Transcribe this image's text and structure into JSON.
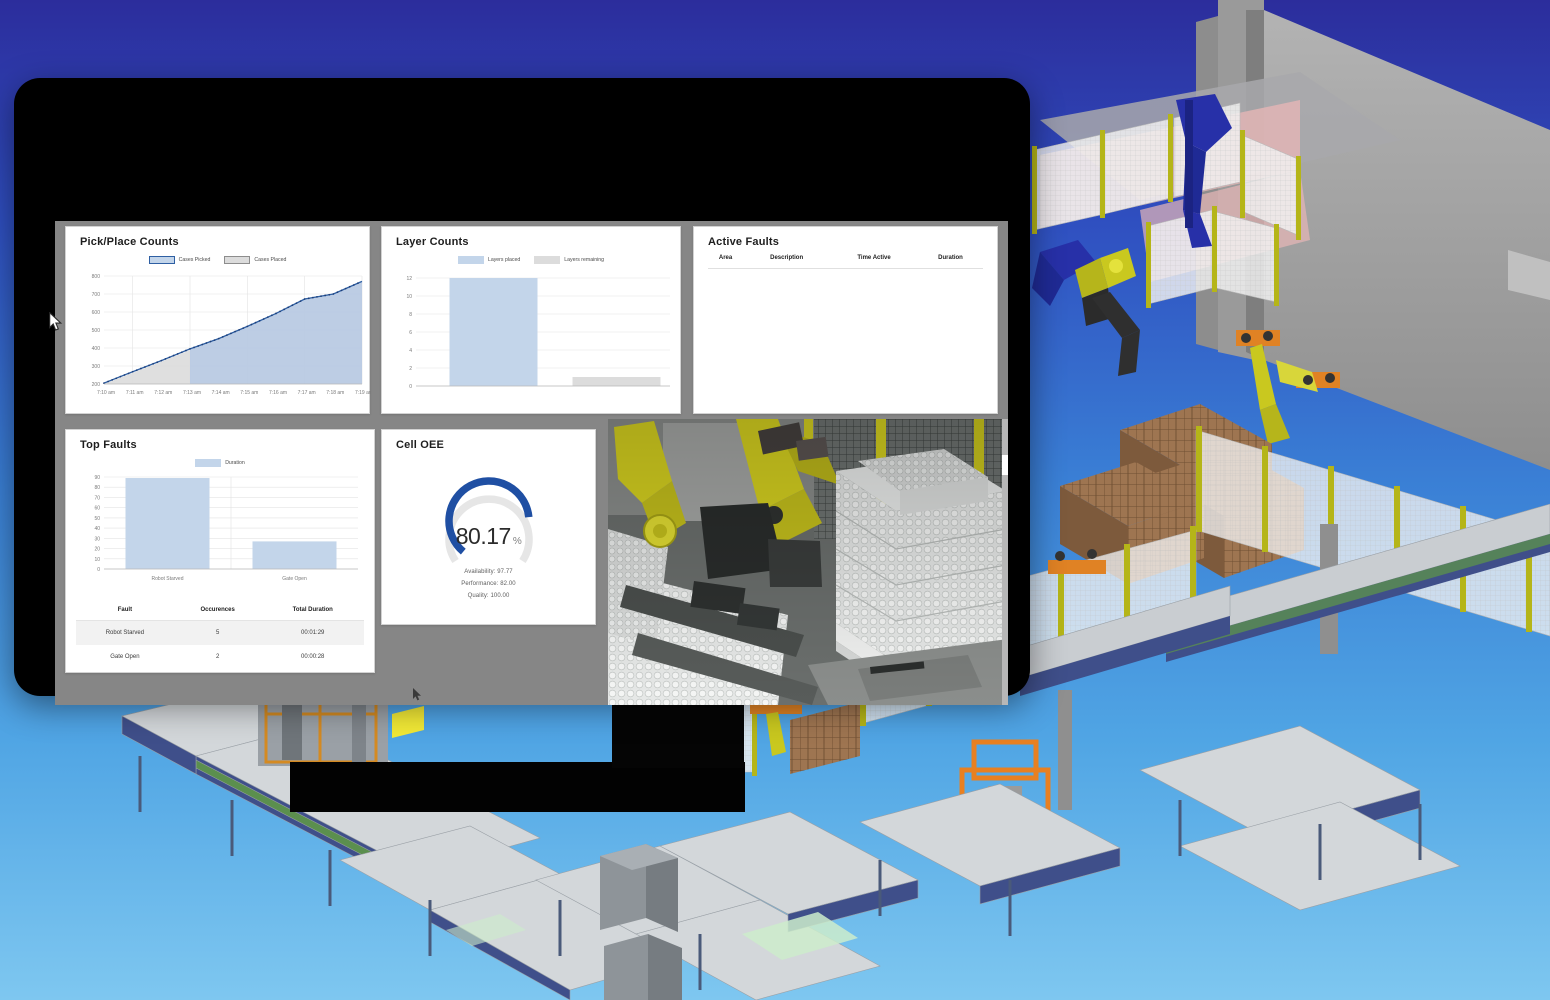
{
  "dashboard": {
    "panels": {
      "pick_place": {
        "title": "Pick/Place Counts"
      },
      "layer_counts": {
        "title": "Layer Counts"
      },
      "active_faults": {
        "title": "Active Faults"
      },
      "top_faults": {
        "title": "Top Faults"
      },
      "cell_oee": {
        "title": "Cell OEE"
      }
    },
    "active_faults_table": {
      "columns": [
        "Area",
        "Description",
        "Time Active",
        "Duration"
      ],
      "rows": []
    },
    "top_faults_table": {
      "columns": [
        "Fault",
        "Occurences",
        "Total Duration"
      ],
      "rows": [
        {
          "fault": "Robot Starved",
          "occurences": "5",
          "total_duration": "00:01:29"
        },
        {
          "fault": "Gate Open",
          "occurences": "2",
          "total_duration": "00:00:28"
        }
      ]
    },
    "cell_oee": {
      "value": "80.17",
      "unit": "%",
      "availability": "Availability: 97.77",
      "performance": "Performance: 82.00",
      "quality": "Quality: 100.00"
    },
    "camera": {
      "label": "live-camera-feed"
    }
  },
  "colors": {
    "accent_blue": "#1f4fa3",
    "series_blue": "#c3d5ea",
    "series_gray": "#dcdcdc",
    "panel_bg": "#ffffff",
    "dashboard_bg": "#868686",
    "gauge_track": "#e6e6e6"
  },
  "chart_data": [
    {
      "id": "pick-place-counts",
      "type": "area",
      "title": "Pick/Place Counts",
      "xlabel": "",
      "ylabel": "",
      "legend": [
        "Cases Picked",
        "Cases Placed"
      ],
      "legend_position": "top",
      "grid": true,
      "x": [
        "7:10 am",
        "7:11 am",
        "7:12 am",
        "7:13 am",
        "7:14 am",
        "7:15 am",
        "7:16 am",
        "7:17 am",
        "7:18 am",
        "7:19 am"
      ],
      "ylim": [
        200,
        800
      ],
      "yticks": [
        200,
        300,
        400,
        500,
        600,
        700,
        800
      ],
      "series": [
        {
          "name": "Cases Picked",
          "values": [
            205,
            268,
            330,
            395,
            452,
            520,
            592,
            672,
            700,
            770
          ]
        },
        {
          "name": "Cases Placed",
          "values": [
            200,
            262,
            324,
            388,
            446,
            512,
            584,
            664,
            692,
            762
          ]
        }
      ]
    },
    {
      "id": "layer-counts",
      "type": "bar",
      "title": "Layer Counts",
      "xlabel": "",
      "ylabel": "",
      "legend": [
        "Layers placed",
        "Layers remaining"
      ],
      "legend_position": "top",
      "grid": true,
      "categories": [
        "Layers placed",
        "Layers remaining"
      ],
      "values": [
        12,
        1
      ],
      "ylim": [
        0,
        12
      ],
      "yticks": [
        0,
        2,
        4,
        6,
        8,
        10,
        12
      ]
    },
    {
      "id": "top-faults",
      "type": "bar",
      "title": "Top Faults",
      "xlabel": "",
      "ylabel": "",
      "legend": [
        "Duration"
      ],
      "legend_position": "top",
      "grid": true,
      "categories": [
        "Robot Starved",
        "Gate Open"
      ],
      "values": [
        89,
        27
      ],
      "ylim": [
        0,
        90
      ],
      "yticks": [
        0,
        10,
        20,
        30,
        40,
        50,
        60,
        70,
        80,
        90
      ]
    },
    {
      "id": "cell-oee-gauge",
      "type": "pie",
      "title": "Cell OEE",
      "legend": [],
      "categories": [
        "OEE",
        "Remaining"
      ],
      "values": [
        80.17,
        19.83
      ],
      "ylim": [
        0,
        100
      ]
    }
  ]
}
